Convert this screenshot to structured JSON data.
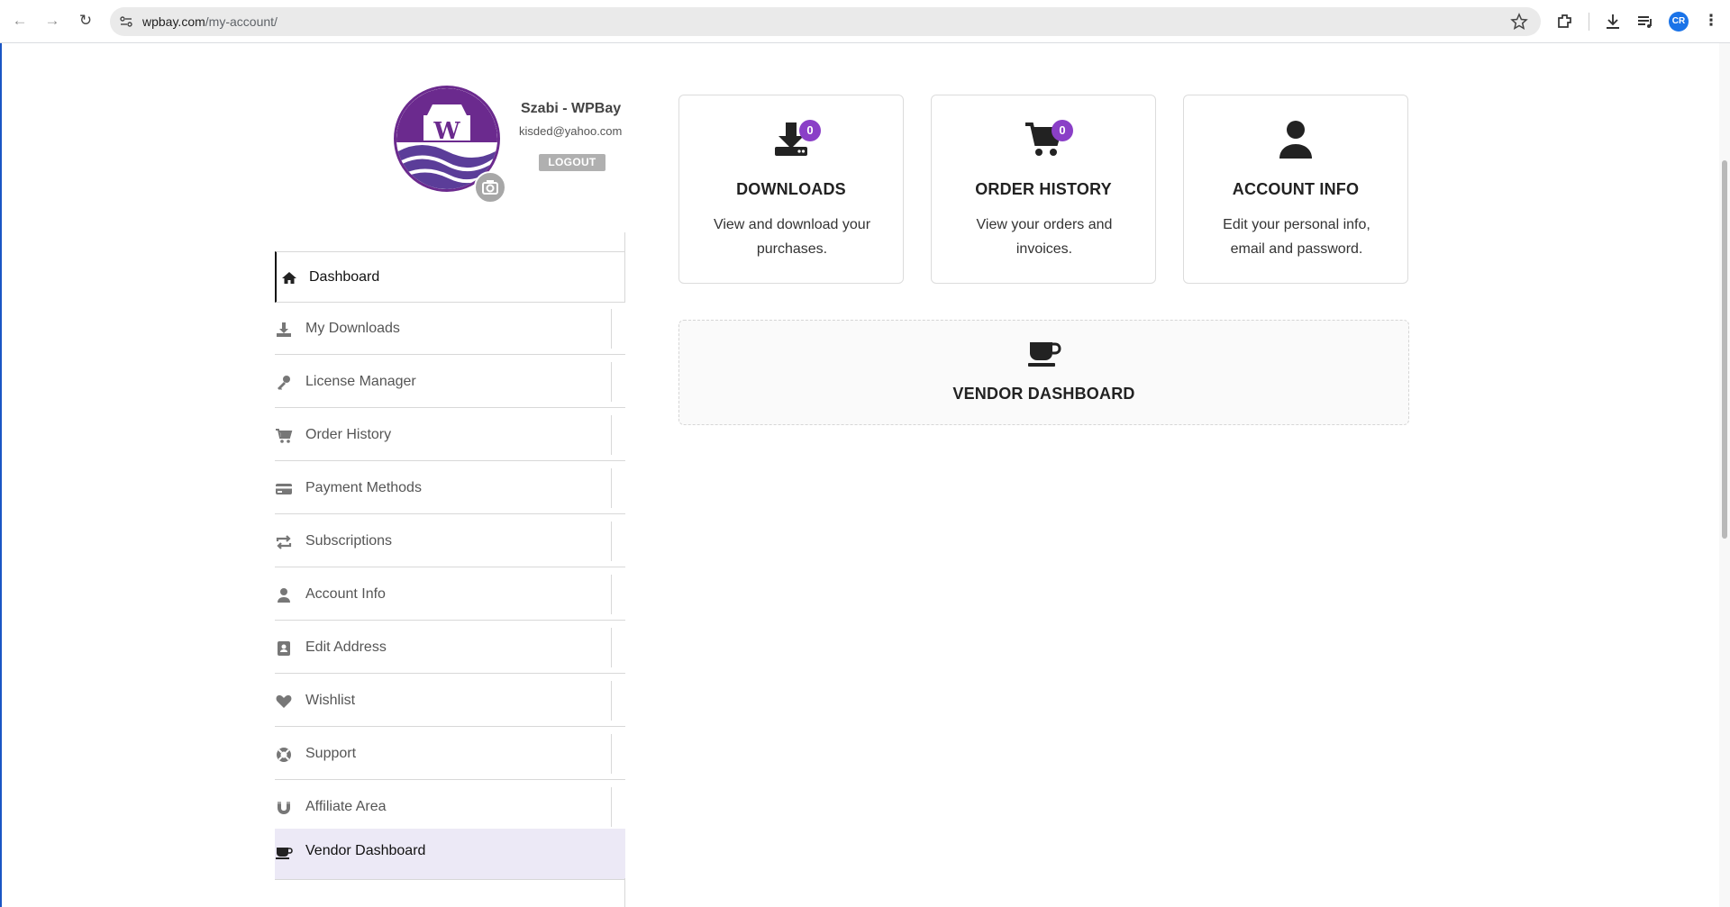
{
  "browser": {
    "url_host": "wpbay.com",
    "url_path": "/my-account/",
    "profile_initials": "CR"
  },
  "profile": {
    "name": "Szabi - WPBay",
    "email": "kisded@yahoo.com",
    "logout_label": "LOGOUT"
  },
  "menu": {
    "items": [
      {
        "label": "Dashboard",
        "icon": "home-icon"
      },
      {
        "label": "My Downloads",
        "icon": "download-icon"
      },
      {
        "label": "License Manager",
        "icon": "key-icon"
      },
      {
        "label": "Order History",
        "icon": "cart-icon"
      },
      {
        "label": "Payment Methods",
        "icon": "credit-card-icon"
      },
      {
        "label": "Subscriptions",
        "icon": "repeat-icon"
      },
      {
        "label": "Account Info",
        "icon": "user-icon"
      },
      {
        "label": "Edit Address",
        "icon": "address-book-icon"
      },
      {
        "label": "Wishlist",
        "icon": "heart-icon"
      },
      {
        "label": "Support",
        "icon": "lifebuoy-icon"
      },
      {
        "label": "Affiliate Area",
        "icon": "magnet-icon"
      },
      {
        "label": "Vendor Dashboard",
        "icon": "coffee-cup-icon"
      }
    ]
  },
  "cards": {
    "downloads": {
      "title": "DOWNLOADS",
      "description": "View and download your purchases.",
      "badge": "0"
    },
    "order_history": {
      "title": "ORDER HISTORY",
      "description": "View your orders and invoices.",
      "badge": "0"
    },
    "account_info": {
      "title": "ACCOUNT INFO",
      "description": "Edit your personal info, email and password."
    },
    "vendor_dashboard": {
      "title": "VENDOR DASHBOARD"
    }
  },
  "colors": {
    "accent": "#8a3fc7",
    "active_highlight": "#ece9f6",
    "logo_purple": "#6b2a8e"
  }
}
